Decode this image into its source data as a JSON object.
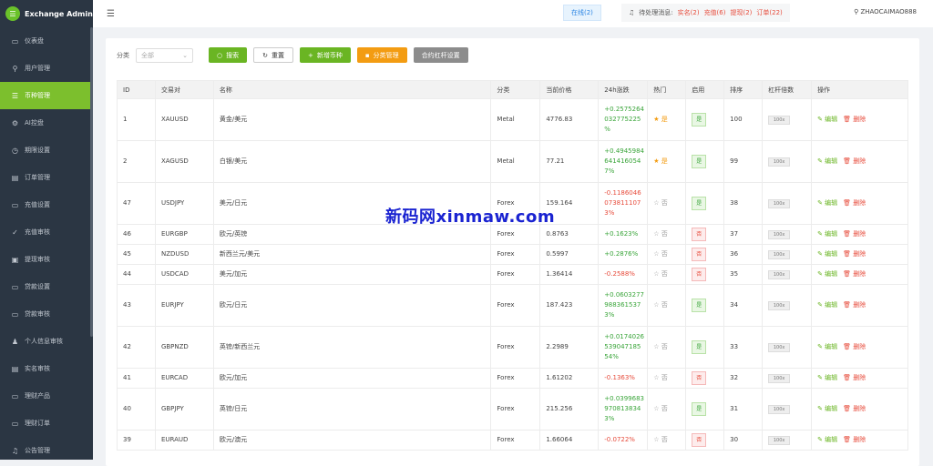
{
  "app": {
    "title": "Exchange Admin"
  },
  "sidebar": {
    "items": [
      {
        "label": "仪表盘",
        "icon": "dashboard-icon",
        "glyph": "▭"
      },
      {
        "label": "用户管理",
        "icon": "user-icon",
        "glyph": "⚲"
      },
      {
        "label": "币种管理",
        "icon": "coin-icon",
        "glyph": "☰",
        "active": true
      },
      {
        "label": "AI控盘",
        "icon": "ai-icon",
        "glyph": "⚙"
      },
      {
        "label": "期限设置",
        "icon": "clock-icon",
        "glyph": "◷"
      },
      {
        "label": "订单管理",
        "icon": "order-icon",
        "glyph": "▤"
      },
      {
        "label": "充值设置",
        "icon": "deposit-icon",
        "glyph": "▭"
      },
      {
        "label": "充值审核",
        "icon": "check-icon",
        "glyph": "✓"
      },
      {
        "label": "提现审核",
        "icon": "withdraw-icon",
        "glyph": "▣"
      },
      {
        "label": "贷款设置",
        "icon": "loan-icon",
        "glyph": "▭"
      },
      {
        "label": "贷款审核",
        "icon": "loan-review-icon",
        "glyph": "▭"
      },
      {
        "label": "个人信息审核",
        "icon": "person-icon",
        "glyph": "♟"
      },
      {
        "label": "实名审核",
        "icon": "id-icon",
        "glyph": "▤"
      },
      {
        "label": "理财产品",
        "icon": "product-icon",
        "glyph": "▭"
      },
      {
        "label": "理财订单",
        "icon": "invest-order-icon",
        "glyph": "▭"
      },
      {
        "label": "公告管理",
        "icon": "notice-icon",
        "glyph": "♫"
      }
    ]
  },
  "topbar": {
    "online": "在线(2)",
    "pending_label": "待处理消息:",
    "realname": "实名(2)",
    "deposit": "充值(6)",
    "withdraw": "提现(2)",
    "orders": "订单(22)",
    "user": "ZHAOCAIMAO888"
  },
  "filters": {
    "category_label": "分类",
    "category_value": "全部",
    "search": "搜索",
    "reset": "重置",
    "add": "新增币种",
    "category_manage": "分类管理",
    "leverage_setting": "合约杠杆设置"
  },
  "table": {
    "headers": [
      "ID",
      "交易对",
      "名称",
      "分类",
      "当前价格",
      "24h涨跌",
      "热门",
      "启用",
      "排序",
      "杠杆倍数",
      "操作"
    ],
    "edit_label": "编辑",
    "delete_label": "删除",
    "hot_yes": "是",
    "hot_no": "否",
    "enabled_label": "是",
    "disabled_label": "否",
    "lev_label": "100x",
    "rows": [
      {
        "id": "1",
        "pair": "XAUUSD",
        "name": "黄金/美元",
        "cat": "Metal",
        "price": "4776.83",
        "change": [
          "+0.2575264",
          "032775225",
          "%"
        ],
        "dir": "pos",
        "hot": true,
        "enabled": true,
        "sort": "100"
      },
      {
        "id": "2",
        "pair": "XAGUSD",
        "name": "白银/美元",
        "cat": "Metal",
        "price": "77.21",
        "change": [
          "+0.4945984",
          "641416054",
          "7%"
        ],
        "dir": "pos",
        "hot": true,
        "enabled": true,
        "sort": "99"
      },
      {
        "id": "47",
        "pair": "USDJPY",
        "name": "美元/日元",
        "cat": "Forex",
        "price": "159.164",
        "change": [
          "-0.1186046",
          "073811107",
          "3%"
        ],
        "dir": "neg",
        "hot": false,
        "enabled": true,
        "sort": "38"
      },
      {
        "id": "46",
        "pair": "EURGBP",
        "name": "欧元/英镑",
        "cat": "Forex",
        "price": "0.8763",
        "change": [
          "+0.1623%"
        ],
        "dir": "pos",
        "hot": false,
        "enabled": false,
        "sort": "37"
      },
      {
        "id": "45",
        "pair": "NZDUSD",
        "name": "新西兰元/美元",
        "cat": "Forex",
        "price": "0.5997",
        "change": [
          "+0.2876%"
        ],
        "dir": "pos",
        "hot": false,
        "enabled": false,
        "sort": "36"
      },
      {
        "id": "44",
        "pair": "USDCAD",
        "name": "美元/加元",
        "cat": "Forex",
        "price": "1.36414",
        "change": [
          "-0.2588%"
        ],
        "dir": "neg",
        "hot": false,
        "enabled": false,
        "sort": "35"
      },
      {
        "id": "43",
        "pair": "EURJPY",
        "name": "欧元/日元",
        "cat": "Forex",
        "price": "187.423",
        "change": [
          "+0.0603277",
          "988361537",
          "3%"
        ],
        "dir": "pos",
        "hot": false,
        "enabled": true,
        "sort": "34"
      },
      {
        "id": "42",
        "pair": "GBPNZD",
        "name": "英镑/新西兰元",
        "cat": "Forex",
        "price": "2.2989",
        "change": [
          "+0.0174026",
          "539047185",
          "54%"
        ],
        "dir": "pos",
        "hot": false,
        "enabled": true,
        "sort": "33"
      },
      {
        "id": "41",
        "pair": "EURCAD",
        "name": "欧元/加元",
        "cat": "Forex",
        "price": "1.61202",
        "change": [
          "-0.1363%"
        ],
        "dir": "neg",
        "hot": false,
        "enabled": false,
        "sort": "32"
      },
      {
        "id": "40",
        "pair": "GBPJPY",
        "name": "英镑/日元",
        "cat": "Forex",
        "price": "215.256",
        "change": [
          "+0.0399683",
          "970813834",
          "3%"
        ],
        "dir": "pos",
        "hot": false,
        "enabled": true,
        "sort": "31"
      },
      {
        "id": "39",
        "pair": "EURAUD",
        "name": "欧元/澳元",
        "cat": "Forex",
        "price": "1.66064",
        "change": [
          "-0.0722%"
        ],
        "dir": "neg",
        "hot": false,
        "enabled": false,
        "sort": "30"
      }
    ]
  },
  "watermark": "新码网xinmaw.com"
}
